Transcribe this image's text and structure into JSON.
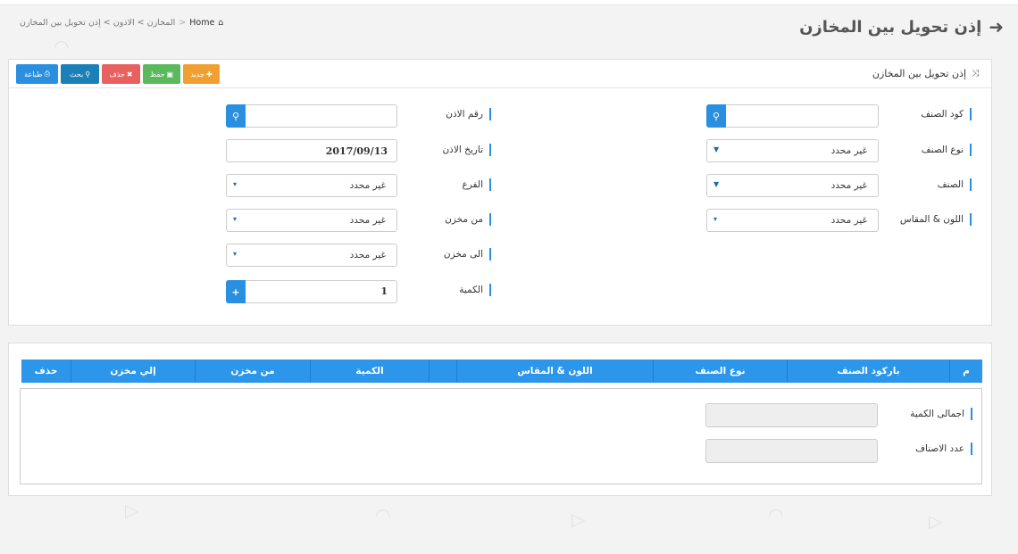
{
  "page": {
    "title": "إذن تحويل بين المخازن",
    "back_icon": "arrow-right-icon"
  },
  "breadcrumb": {
    "home": "Home",
    "sep": ">",
    "path": "المخازن > الاذون > إذن تحويل بين المخازن"
  },
  "panel": {
    "title": "إذن تحويل بين المخازن"
  },
  "toolbar": {
    "new": "جديد",
    "save": "حفظ",
    "delete": "حذف",
    "search": "بحث",
    "print": "طباعة"
  },
  "form": {
    "item_code": {
      "label": "كود الصنف",
      "value": ""
    },
    "item_type": {
      "label": "نوع الصنف",
      "value": "غير محدد"
    },
    "item": {
      "label": "الصنف",
      "value": "غير محدد"
    },
    "color_size": {
      "label": "اللون & المقاس",
      "value": "غير محدد"
    },
    "permit_no": {
      "label": "رقم الاذن",
      "value": ""
    },
    "permit_date": {
      "label": "تاريخ الاذن",
      "value": "2017/09/13"
    },
    "branch": {
      "label": "الفرع",
      "value": "غير محدد"
    },
    "from_store": {
      "label": "من مخزن",
      "value": "غير محدد"
    },
    "to_store": {
      "label": "الى مخزن",
      "value": "غير محدد"
    },
    "quantity": {
      "label": "الكمية",
      "value": "1"
    }
  },
  "table": {
    "columns": [
      "م",
      "باركود الصنف",
      "نوع الصنف",
      "اللون & المقاس",
      "",
      "الكمية",
      "من مخزن",
      "إلي مخزن",
      "حذف"
    ]
  },
  "totals": {
    "total_qty_label": "اجمالى الكمية",
    "total_qty_value": "",
    "items_count_label": "عدد الاصناف",
    "items_count_value": ""
  },
  "colors": {
    "accent": "#2b8fe0",
    "header": "#2b96ea",
    "new": "#f0a030",
    "save": "#5cb85c",
    "delete": "#e96060",
    "search": "#1b7fb8",
    "print": "#2b8fe0"
  }
}
